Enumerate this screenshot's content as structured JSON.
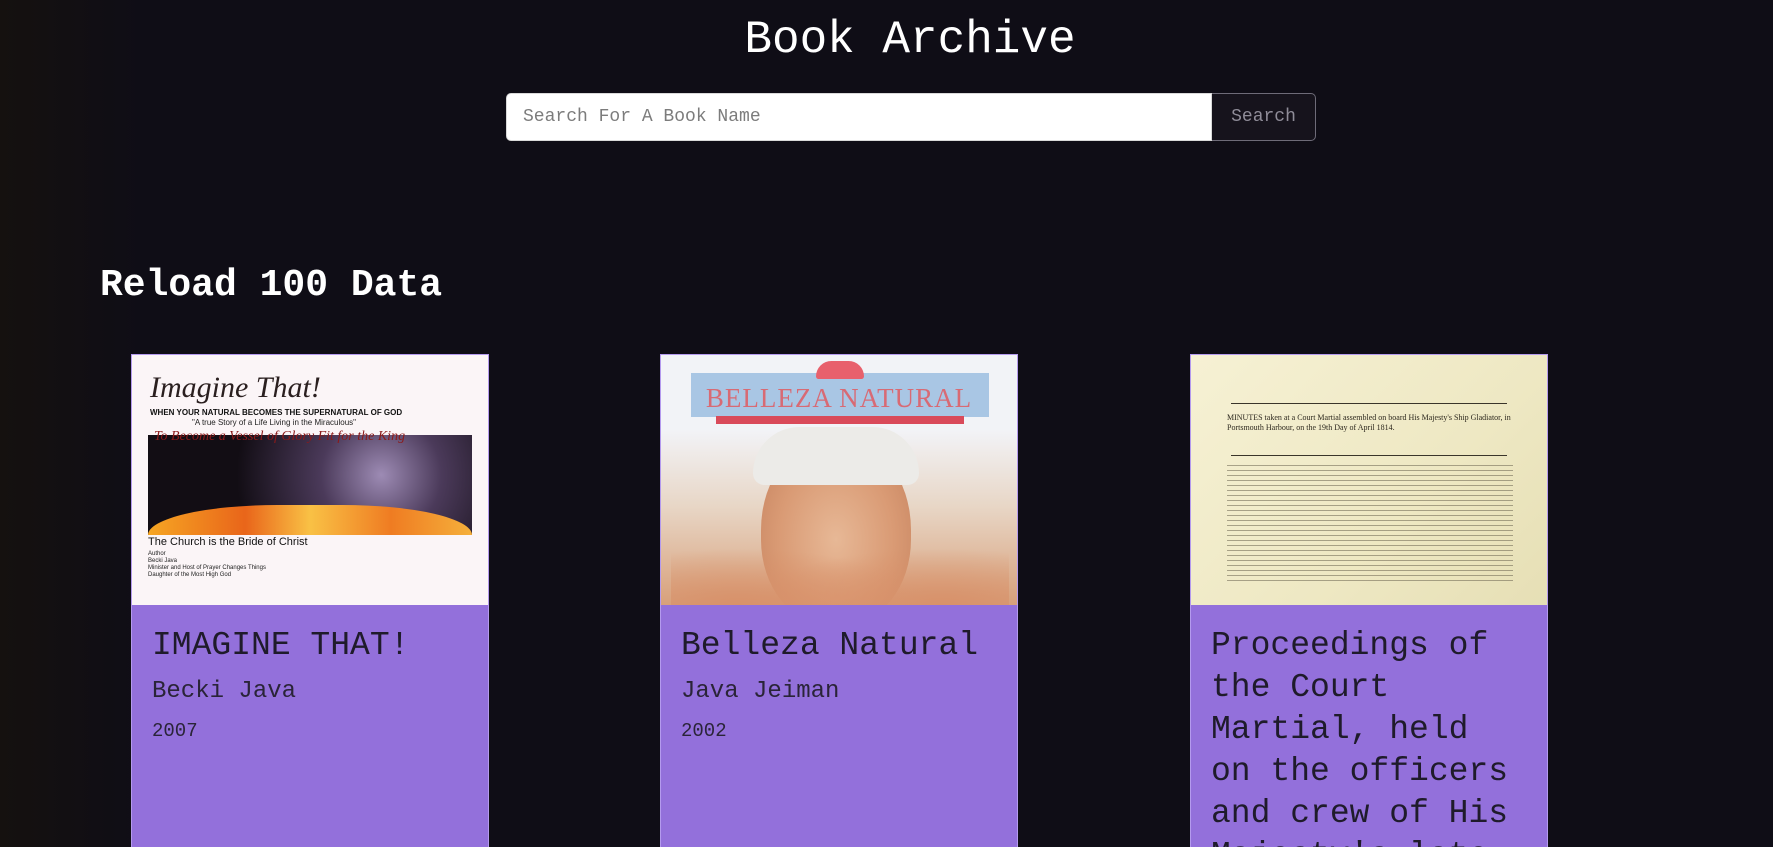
{
  "header": {
    "title": "Book Archive"
  },
  "search": {
    "placeholder": "Search For A Book Name",
    "value": "",
    "button_label": "Search"
  },
  "section": {
    "heading": "Reload 100 Data"
  },
  "books": [
    {
      "title": "IMAGINE THAT!",
      "author": "Becki Java",
      "year": "2007",
      "cover": {
        "script_title": "Imagine That!",
        "tagline": "When your natural becomes the supernatural of God",
        "subtitle": "\"A true Story of a Life Living in the Miraculous\"",
        "italic_line": "To Become a Vessel of Glory Fit for the King",
        "caption": "The Church is the Bride of Christ",
        "small_lines": [
          "Author",
          "Becki Java",
          "Minister and Host of Prayer Changes Things",
          "Daughter of the Most High God"
        ]
      }
    },
    {
      "title": "Belleza Natural",
      "author": "Java Jeiman",
      "year": "2002",
      "cover": {
        "cover_title": "BELLEZA NATURAL"
      }
    },
    {
      "title": "Proceedings of the Court Martial, held on the officers and crew of His Majesty's late",
      "author": "",
      "year": "",
      "cover": {
        "line1": "MINUTES taken at a Court Martial assembled on board His Majesty's Ship Gladiator, in Portsmouth Harbour, on the 19th Day of April 1814."
      }
    }
  ],
  "colors": {
    "background": "#0f0d16",
    "card": "#9370db",
    "accent_border": "#b49aee"
  }
}
